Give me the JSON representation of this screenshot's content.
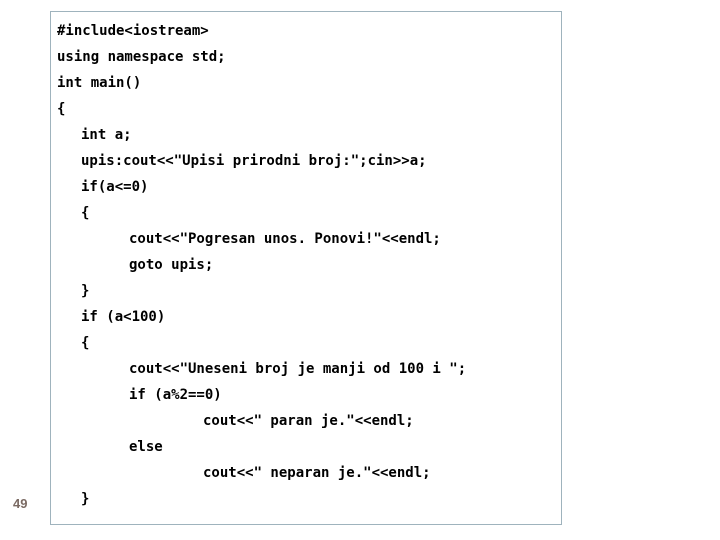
{
  "slide": {
    "number": "49",
    "number_color": "#7a6a63",
    "background_color": "#ffffff",
    "box_border_color": "#9fb3bd",
    "code_text_color": "#000000"
  },
  "code": {
    "language": "cpp",
    "lines": [
      {
        "indent": 0,
        "text": "#include<iostream>"
      },
      {
        "indent": 0,
        "text": "using namespace std;"
      },
      {
        "indent": 0,
        "text": "int main()"
      },
      {
        "indent": 0,
        "text": "{"
      },
      {
        "indent": 1,
        "text": "int a;"
      },
      {
        "indent": 1,
        "text": "upis:cout<<\"Upisi prirodni broj:\";cin>>a;"
      },
      {
        "indent": 1,
        "text": "if(a<=0)"
      },
      {
        "indent": 1,
        "text": "{"
      },
      {
        "indent": 2,
        "text": "cout<<\"Pogresan unos. Ponovi!\"<<endl;"
      },
      {
        "indent": 2,
        "text": "goto upis;"
      },
      {
        "indent": 1,
        "text": "}"
      },
      {
        "indent": 1,
        "text": "if (a<100)"
      },
      {
        "indent": 1,
        "text": "{"
      },
      {
        "indent": 2,
        "text": "cout<<\"Uneseni broj je manji od 100 i \";"
      },
      {
        "indent": 2,
        "text": "if (a%2==0)"
      },
      {
        "indent": 3,
        "text": "cout<<\" paran je.\"<<endl;"
      },
      {
        "indent": 2,
        "text": "else"
      },
      {
        "indent": 3,
        "text": "cout<<\" neparan je.\"<<endl;"
      },
      {
        "indent": 1,
        "text": "}"
      }
    ]
  }
}
